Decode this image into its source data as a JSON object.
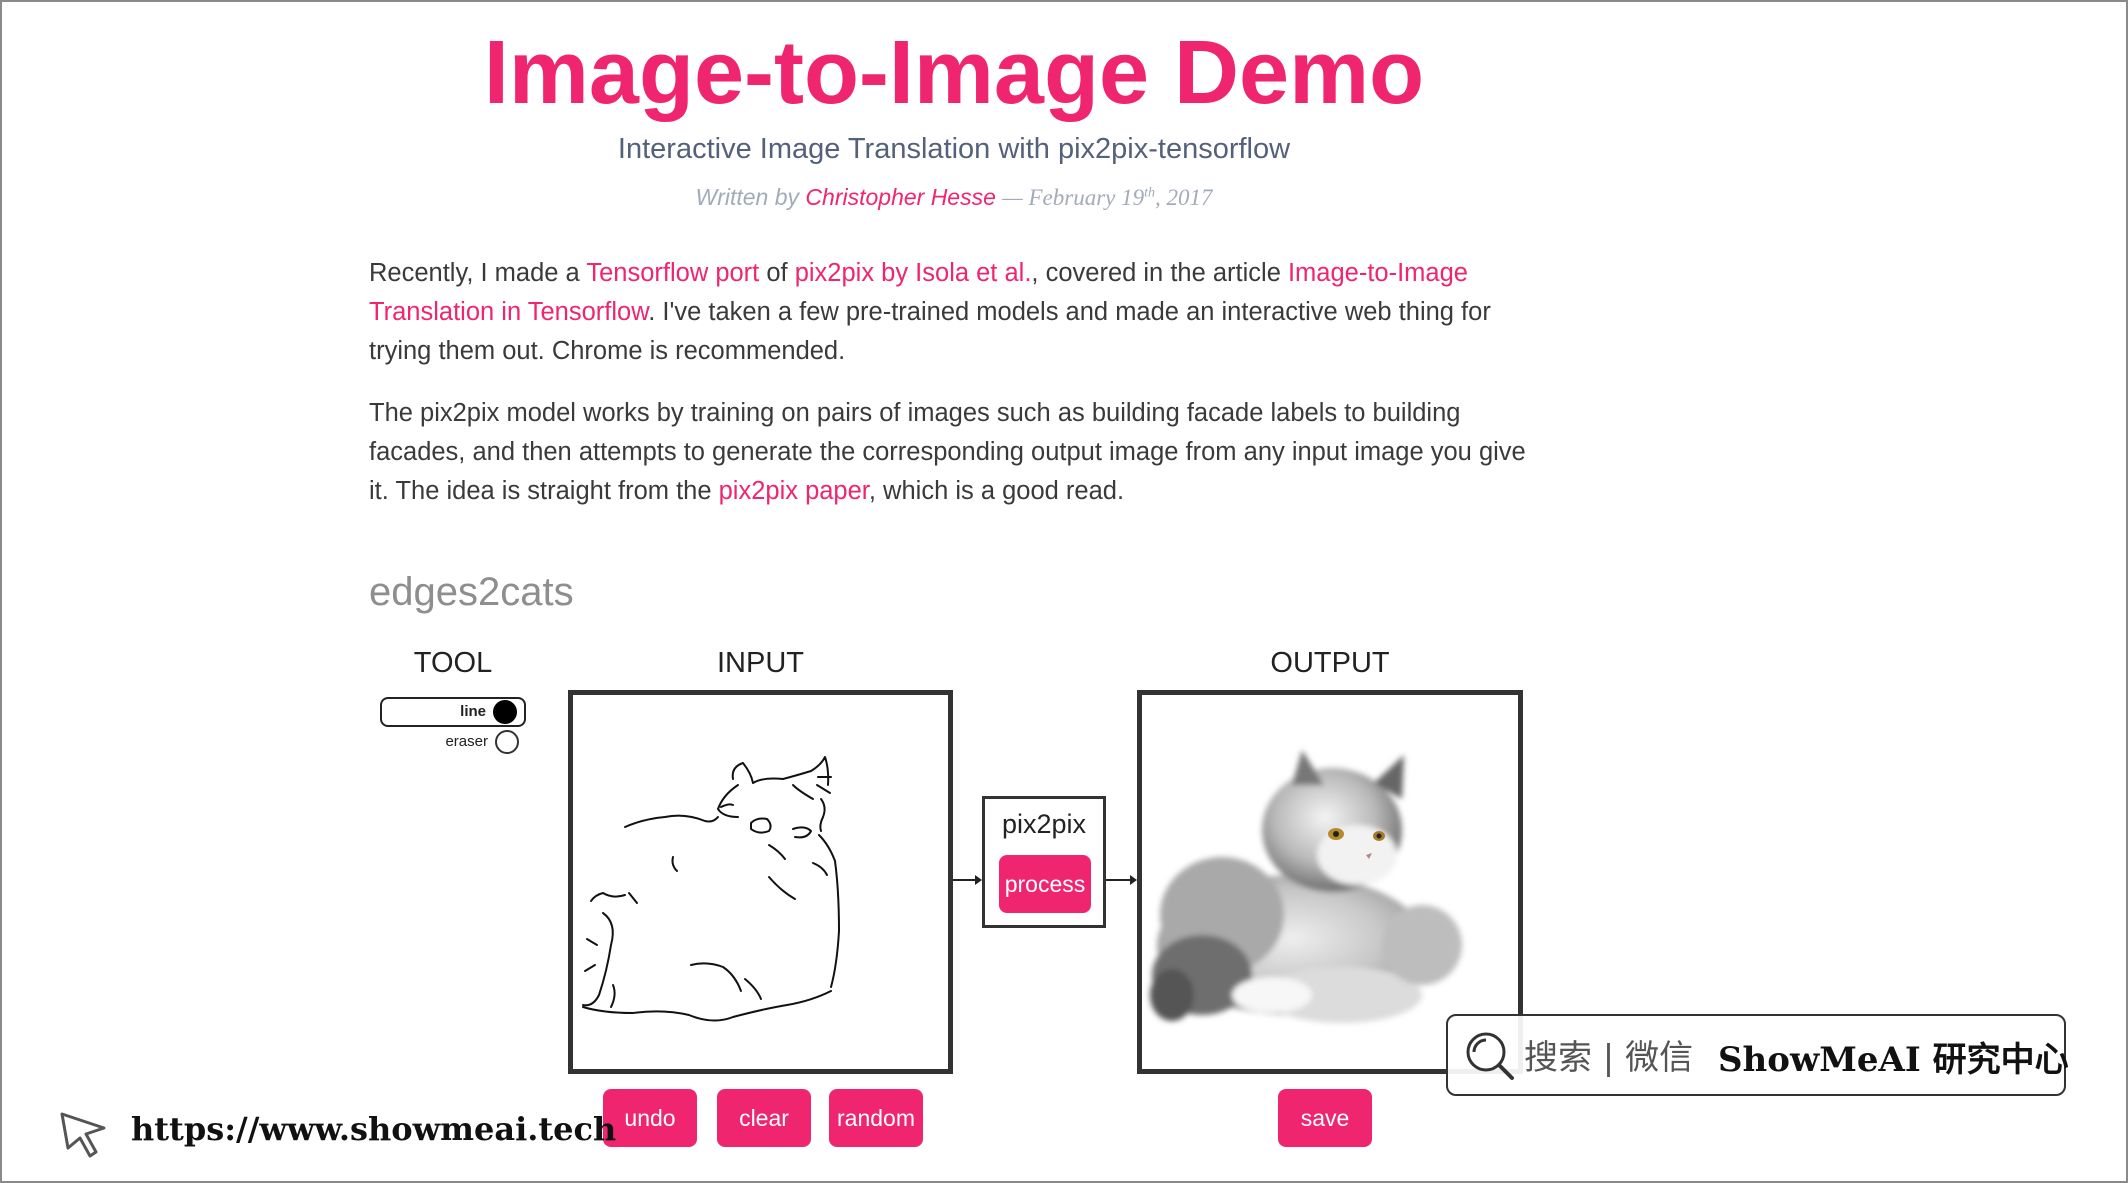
{
  "header": {
    "title": "Image-to-Image Demo",
    "subtitle": "Interactive Image Translation with pix2pix-tensorflow",
    "byline_prefix": "Written by",
    "author": "Christopher Hesse",
    "date_prefix": "— February 19",
    "date_sup": "th",
    "date_suffix": ", 2017"
  },
  "intro": {
    "p1_a": "Recently, I made a ",
    "p1_link1": "Tensorflow port",
    "p1_b": " of ",
    "p1_link2": "pix2pix by Isola et al.",
    "p1_c": ", covered in the article ",
    "p1_link3": "Image-to-Image Translation in Tensorflow",
    "p1_d": ". I've taken a few pre-trained models and made an interactive web thing for trying them out. Chrome is recommended.",
    "p2_a": "The pix2pix model works by training on pairs of images such as building facade labels to building facades, and then attempts to generate the corresponding output image from any input image you give it. The idea is straight from the ",
    "p2_link": "pix2pix paper",
    "p2_b": ", which is a good read."
  },
  "demo": {
    "section_title": "edges2cats",
    "tool_label": "TOOL",
    "input_label": "INPUT",
    "output_label": "OUTPUT",
    "tools": {
      "line": "line",
      "eraser": "eraser",
      "selected": "line"
    },
    "model_name": "pix2pix",
    "buttons": {
      "process": "process",
      "undo": "undo",
      "clear": "clear",
      "random": "random",
      "save": "save"
    }
  },
  "watermark": {
    "search_text": "搜索 | 微信",
    "brand": "ShowMeAI 研究中心"
  },
  "footer": {
    "url": "https://www.showmeai.tech"
  },
  "colors": {
    "accent": "#f0256f",
    "text": "#3a3a3a",
    "muted": "#a3aab9"
  }
}
